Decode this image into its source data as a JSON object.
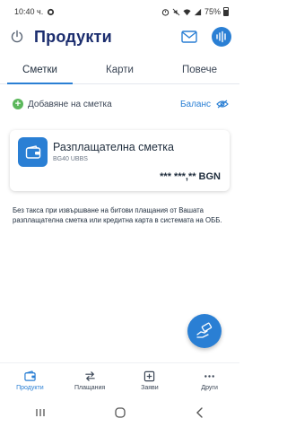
{
  "status_bar": {
    "time": "10:40 ч.",
    "battery_level": "75%"
  },
  "header": {
    "title": "Продукти",
    "icons": [
      "power-icon",
      "mail-icon",
      "voice-assistant-icon"
    ]
  },
  "tabs": [
    {
      "label": "Сметки",
      "active": true
    },
    {
      "label": "Карти",
      "active": false
    },
    {
      "label": "Повече",
      "active": false
    }
  ],
  "actions": {
    "add_account_label": "Добавяне на сметка",
    "balance_label": "Баланс"
  },
  "account": {
    "name": "Разплащателна сметка",
    "iban": "BG40 UBBS",
    "balance": "*** ***,** BGN"
  },
  "promo_text": "Без такса при извършване на битови плащания от Вашата разплащателна сметка или кредитна карта в системата на ОББ.",
  "bottom_nav": [
    {
      "label": "Продукти",
      "icon": "wallet-icon",
      "active": true
    },
    {
      "label": "Плащания",
      "icon": "transfer-arrows-icon",
      "active": false
    },
    {
      "label": "Заяви",
      "icon": "plus-square-icon",
      "active": false
    },
    {
      "label": "Други",
      "icon": "more-dots-icon",
      "active": false
    }
  ],
  "colors": {
    "accent": "#2a7fd4",
    "title": "#1b2d6e",
    "add_green": "#5cb85c"
  }
}
